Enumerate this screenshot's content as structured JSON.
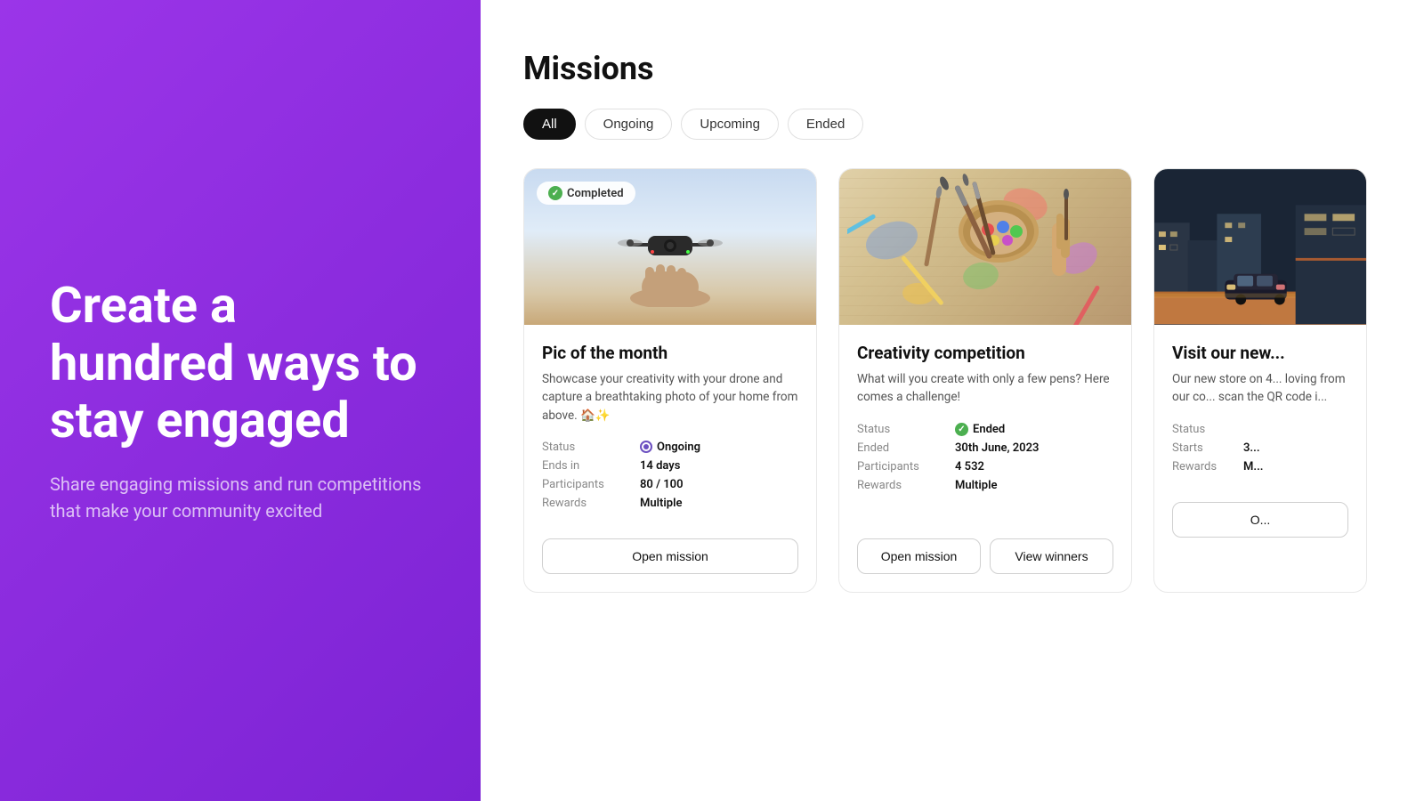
{
  "left": {
    "hero_title": "Create a hundred ways to stay engaged",
    "hero_subtitle": "Share engaging missions and run competitions that make your community excited"
  },
  "right": {
    "page_title": "Missions",
    "filters": [
      {
        "id": "all",
        "label": "All",
        "active": true
      },
      {
        "id": "ongoing",
        "label": "Ongoing",
        "active": false
      },
      {
        "id": "upcoming",
        "label": "Upcoming",
        "active": false
      },
      {
        "id": "ended",
        "label": "Ended",
        "active": false
      }
    ],
    "cards": [
      {
        "id": "card1",
        "badge": "Completed",
        "title": "Pic of the month",
        "description": "Showcase your creativity with your drone and capture a breathtaking photo of your home from above. 🏠✨",
        "status_label": "Status",
        "status_value": "Ongoing",
        "ends_in_label": "Ends in",
        "ends_in_value": "14 days",
        "participants_label": "Participants",
        "participants_value": "80 / 100",
        "rewards_label": "Rewards",
        "rewards_value": "Multiple",
        "btn_open": "Open mission"
      },
      {
        "id": "card2",
        "title": "Creativity competition",
        "description": "What will you create with only a few pens? Here comes a challenge!",
        "status_label": "Status",
        "status_value": "Ended",
        "ended_label": "Ended",
        "ended_value": "30th June, 2023",
        "participants_label": "Participants",
        "participants_value": "4 532",
        "rewards_label": "Rewards",
        "rewards_value": "Multiple",
        "btn_open": "Open mission",
        "btn_winners": "View winners"
      },
      {
        "id": "card3",
        "title": "Visit our new...",
        "description": "Our new store on 4... loving from our co... scan the QR code i...",
        "status_label": "Status",
        "starts_label": "Starts",
        "starts_value": "3...",
        "rewards_label": "Rewards",
        "rewards_value": "M...",
        "btn_label": "O..."
      }
    ]
  }
}
